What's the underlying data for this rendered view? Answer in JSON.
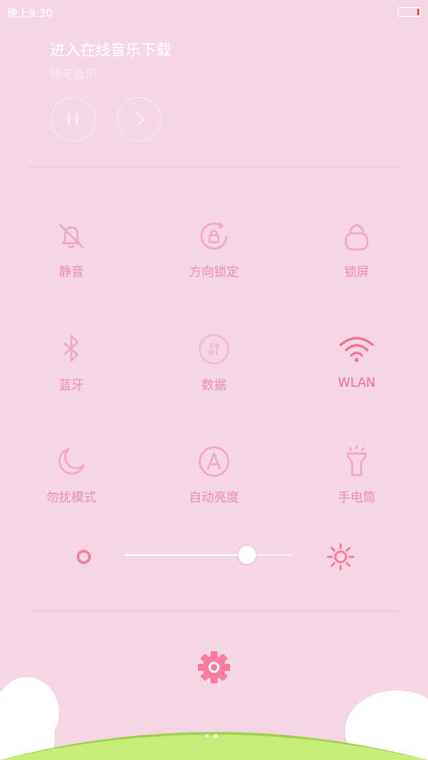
{
  "status": {
    "time": "晚上9:30",
    "battery_level": 0.1
  },
  "music": {
    "title": "进入在线音乐下载",
    "subtitle": "畅无音乐",
    "pause_icon": "pause-icon",
    "next_icon": "chevron-right-icon"
  },
  "toggles": [
    {
      "label": "静音",
      "icon": "bell-off-icon"
    },
    {
      "label": "方向锁定",
      "icon": "rotation-lock-icon"
    },
    {
      "label": "锁屏",
      "icon": "lock-icon"
    },
    {
      "label": "蓝牙",
      "icon": "bluetooth-icon"
    },
    {
      "label": "数据",
      "icon": "mobile-data-icon"
    },
    {
      "label": "WLAN",
      "icon": "wifi-icon",
      "active": true
    },
    {
      "label": "勿扰模式",
      "icon": "moon-icon"
    },
    {
      "label": "自动亮度",
      "icon": "auto-brightness-icon"
    },
    {
      "label": "手电筒",
      "icon": "flashlight-icon"
    }
  ],
  "brightness": {
    "level": 0.73,
    "low_icon": "brightness-low-icon",
    "high_icon": "brightness-high-icon"
  },
  "settings": {
    "icon": "gear-icon"
  },
  "page_indicator": {
    "count": 2,
    "current": 1
  },
  "colors": {
    "background": "#f4d6e5",
    "accent": "#f56d95",
    "label": "#f08fae",
    "icon_faint": "#f2a9c2",
    "grass": "#c8ee7a"
  }
}
